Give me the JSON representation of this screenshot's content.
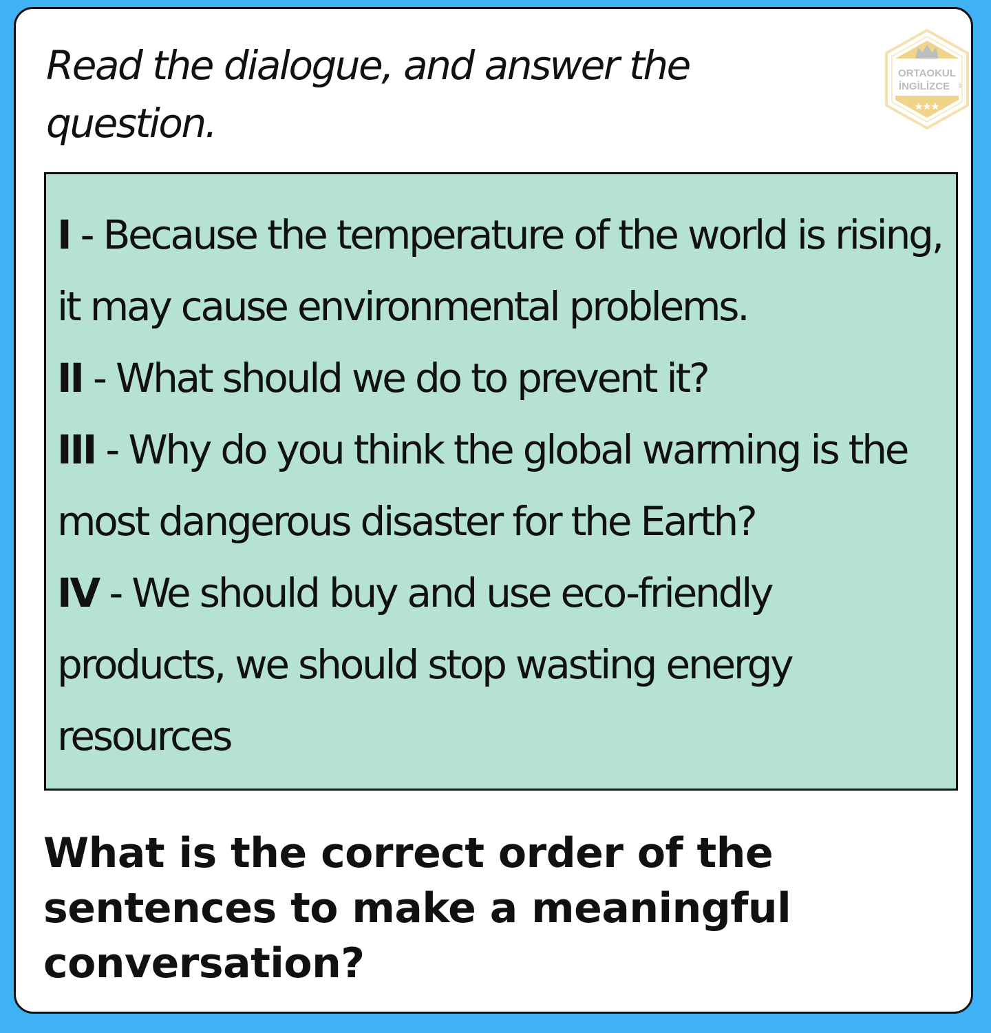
{
  "instruction": "Read the dialogue, and answer the question.",
  "logo": {
    "line1": "ORTAOKUL",
    "line2": "İNGİLİZCE",
    "side": ".net",
    "color": "#f0d48a"
  },
  "dialogue": [
    {
      "num": "I",
      "sep": " - ",
      "text": "Because the temperature of the world is rising, it may cause environmental problems."
    },
    {
      "num": "II",
      "sep": " - ",
      "text": "What should we do to prevent it?"
    },
    {
      "num": "III",
      "sep": " - ",
      "text": "Why do you think the global warming is the most dangerous disaster for the Earth?"
    },
    {
      "num": "IV",
      "sep": " - ",
      "text": "We should buy and use eco-friendly products, we should stop wasting energy resources"
    }
  ],
  "question": "What is the correct order of the sentences to make a meaningful conversation?",
  "colors": {
    "background": "#3fb2f6",
    "card": "#ffffff",
    "dialogue_box": "#b5e2d5"
  }
}
